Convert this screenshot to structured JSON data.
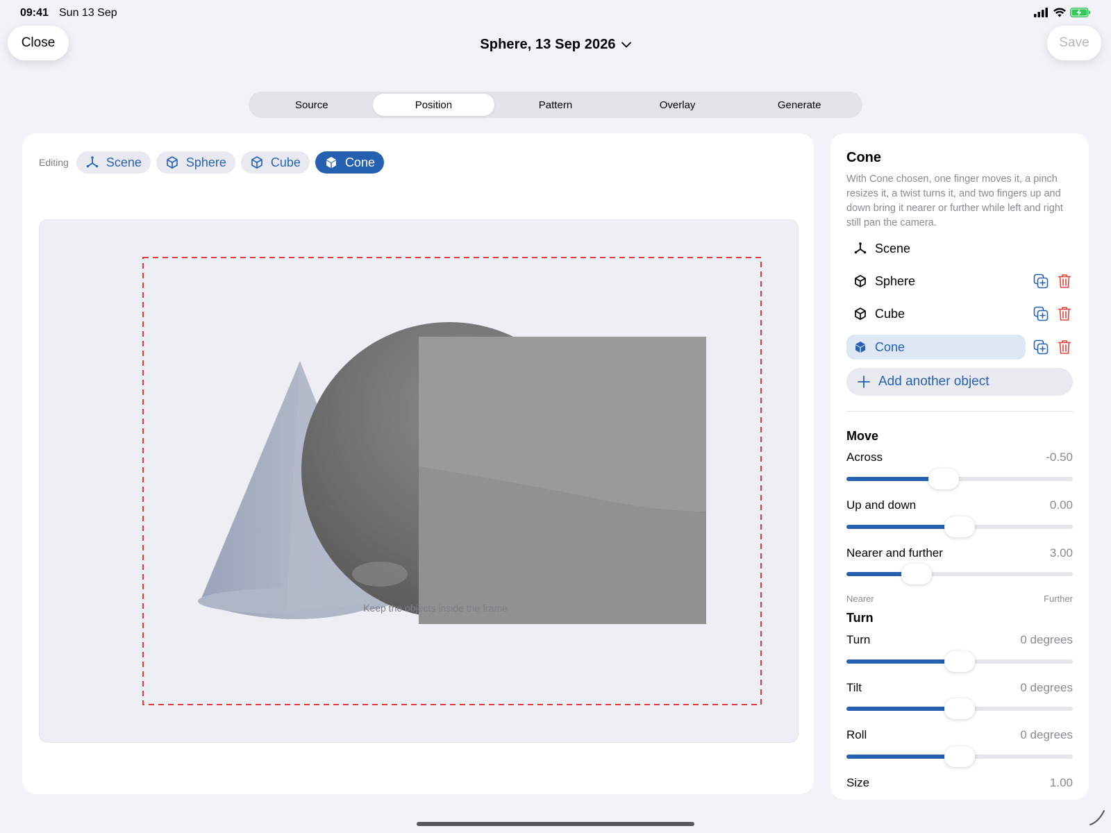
{
  "status": {
    "time": "09:41",
    "date": "Sun 13 Sep"
  },
  "nav": {
    "close_label": "Close",
    "save_label": "Save",
    "title": "Sphere, 13 Sep 2026"
  },
  "tabs": [
    {
      "label": "Source",
      "active": false
    },
    {
      "label": "Position",
      "active": true
    },
    {
      "label": "Pattern",
      "active": false
    },
    {
      "label": "Overlay",
      "active": false
    },
    {
      "label": "Generate",
      "active": false
    }
  ],
  "editing": {
    "label": "Editing",
    "chips": [
      {
        "label": "Scene",
        "icon": "scene-axes-icon",
        "active": false
      },
      {
        "label": "Sphere",
        "icon": "cube-outline-icon",
        "active": false
      },
      {
        "label": "Cube",
        "icon": "cube-outline-icon",
        "active": false
      },
      {
        "label": "Cone",
        "icon": "cube-filled-icon",
        "active": true
      }
    ]
  },
  "viewport": {
    "frame_hint": "Keep the objects inside the frame",
    "frame_color": "#e03a3a"
  },
  "panel": {
    "title": "Cone",
    "description": "With Cone chosen, one finger moves it, a pinch resizes it, a twist turns it, and two fingers up and down bring it nearer or further while left and right still pan the camera.",
    "objects": [
      {
        "name": "Scene",
        "icon": "scene-axes-icon",
        "selected": false,
        "actions": false
      },
      {
        "name": "Sphere",
        "icon": "cube-outline-icon",
        "selected": false,
        "actions": true
      },
      {
        "name": "Cube",
        "icon": "cube-outline-icon",
        "selected": false,
        "actions": true
      },
      {
        "name": "Cone",
        "icon": "cube-filled-icon",
        "selected": true,
        "actions": true
      }
    ],
    "add_label": "Add another object",
    "move": {
      "title": "Move",
      "across": {
        "label": "Across",
        "value": "-0.50",
        "fraction": 0.43
      },
      "updown": {
        "label": "Up and down",
        "value": "0.00",
        "fraction": 0.5
      },
      "nearer": {
        "label": "Nearer and further",
        "value": "3.00",
        "fraction": 0.31
      },
      "range_min": "Nearer",
      "range_max": "Further"
    },
    "turn": {
      "title": "Turn",
      "turn": {
        "label": "Turn",
        "value": "0 degrees",
        "fraction": 0.5
      },
      "tilt": {
        "label": "Tilt",
        "value": "0 degrees",
        "fraction": 0.5
      },
      "roll": {
        "label": "Roll",
        "value": "0 degrees",
        "fraction": 0.5
      }
    },
    "size": {
      "label": "Size",
      "value": "1.00"
    }
  },
  "colors": {
    "accent": "#2561b0",
    "delete": "#e0413a",
    "background": "#f2f2f7"
  }
}
